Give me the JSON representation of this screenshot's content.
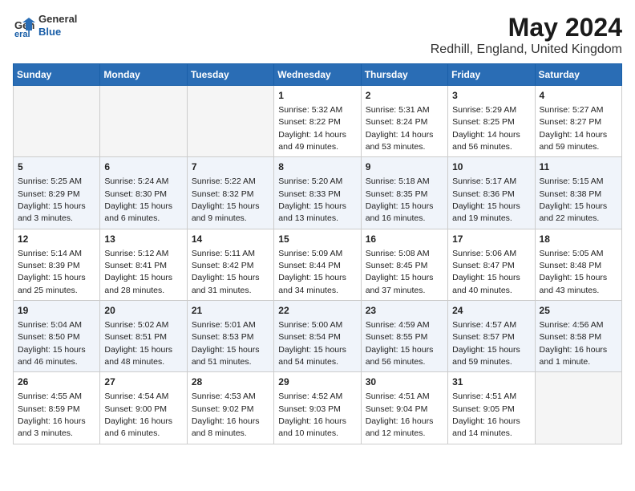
{
  "logo": {
    "line1": "General",
    "line2": "Blue"
  },
  "title": "May 2024",
  "subtitle": "Redhill, England, United Kingdom",
  "headers": [
    "Sunday",
    "Monday",
    "Tuesday",
    "Wednesday",
    "Thursday",
    "Friday",
    "Saturday"
  ],
  "weeks": [
    [
      {
        "day": "",
        "info": ""
      },
      {
        "day": "",
        "info": ""
      },
      {
        "day": "",
        "info": ""
      },
      {
        "day": "1",
        "info": "Sunrise: 5:32 AM\nSunset: 8:22 PM\nDaylight: 14 hours\nand 49 minutes."
      },
      {
        "day": "2",
        "info": "Sunrise: 5:31 AM\nSunset: 8:24 PM\nDaylight: 14 hours\nand 53 minutes."
      },
      {
        "day": "3",
        "info": "Sunrise: 5:29 AM\nSunset: 8:25 PM\nDaylight: 14 hours\nand 56 minutes."
      },
      {
        "day": "4",
        "info": "Sunrise: 5:27 AM\nSunset: 8:27 PM\nDaylight: 14 hours\nand 59 minutes."
      }
    ],
    [
      {
        "day": "5",
        "info": "Sunrise: 5:25 AM\nSunset: 8:29 PM\nDaylight: 15 hours\nand 3 minutes."
      },
      {
        "day": "6",
        "info": "Sunrise: 5:24 AM\nSunset: 8:30 PM\nDaylight: 15 hours\nand 6 minutes."
      },
      {
        "day": "7",
        "info": "Sunrise: 5:22 AM\nSunset: 8:32 PM\nDaylight: 15 hours\nand 9 minutes."
      },
      {
        "day": "8",
        "info": "Sunrise: 5:20 AM\nSunset: 8:33 PM\nDaylight: 15 hours\nand 13 minutes."
      },
      {
        "day": "9",
        "info": "Sunrise: 5:18 AM\nSunset: 8:35 PM\nDaylight: 15 hours\nand 16 minutes."
      },
      {
        "day": "10",
        "info": "Sunrise: 5:17 AM\nSunset: 8:36 PM\nDaylight: 15 hours\nand 19 minutes."
      },
      {
        "day": "11",
        "info": "Sunrise: 5:15 AM\nSunset: 8:38 PM\nDaylight: 15 hours\nand 22 minutes."
      }
    ],
    [
      {
        "day": "12",
        "info": "Sunrise: 5:14 AM\nSunset: 8:39 PM\nDaylight: 15 hours\nand 25 minutes."
      },
      {
        "day": "13",
        "info": "Sunrise: 5:12 AM\nSunset: 8:41 PM\nDaylight: 15 hours\nand 28 minutes."
      },
      {
        "day": "14",
        "info": "Sunrise: 5:11 AM\nSunset: 8:42 PM\nDaylight: 15 hours\nand 31 minutes."
      },
      {
        "day": "15",
        "info": "Sunrise: 5:09 AM\nSunset: 8:44 PM\nDaylight: 15 hours\nand 34 minutes."
      },
      {
        "day": "16",
        "info": "Sunrise: 5:08 AM\nSunset: 8:45 PM\nDaylight: 15 hours\nand 37 minutes."
      },
      {
        "day": "17",
        "info": "Sunrise: 5:06 AM\nSunset: 8:47 PM\nDaylight: 15 hours\nand 40 minutes."
      },
      {
        "day": "18",
        "info": "Sunrise: 5:05 AM\nSunset: 8:48 PM\nDaylight: 15 hours\nand 43 minutes."
      }
    ],
    [
      {
        "day": "19",
        "info": "Sunrise: 5:04 AM\nSunset: 8:50 PM\nDaylight: 15 hours\nand 46 minutes."
      },
      {
        "day": "20",
        "info": "Sunrise: 5:02 AM\nSunset: 8:51 PM\nDaylight: 15 hours\nand 48 minutes."
      },
      {
        "day": "21",
        "info": "Sunrise: 5:01 AM\nSunset: 8:53 PM\nDaylight: 15 hours\nand 51 minutes."
      },
      {
        "day": "22",
        "info": "Sunrise: 5:00 AM\nSunset: 8:54 PM\nDaylight: 15 hours\nand 54 minutes."
      },
      {
        "day": "23",
        "info": "Sunrise: 4:59 AM\nSunset: 8:55 PM\nDaylight: 15 hours\nand 56 minutes."
      },
      {
        "day": "24",
        "info": "Sunrise: 4:57 AM\nSunset: 8:57 PM\nDaylight: 15 hours\nand 59 minutes."
      },
      {
        "day": "25",
        "info": "Sunrise: 4:56 AM\nSunset: 8:58 PM\nDaylight: 16 hours\nand 1 minute."
      }
    ],
    [
      {
        "day": "26",
        "info": "Sunrise: 4:55 AM\nSunset: 8:59 PM\nDaylight: 16 hours\nand 3 minutes."
      },
      {
        "day": "27",
        "info": "Sunrise: 4:54 AM\nSunset: 9:00 PM\nDaylight: 16 hours\nand 6 minutes."
      },
      {
        "day": "28",
        "info": "Sunrise: 4:53 AM\nSunset: 9:02 PM\nDaylight: 16 hours\nand 8 minutes."
      },
      {
        "day": "29",
        "info": "Sunrise: 4:52 AM\nSunset: 9:03 PM\nDaylight: 16 hours\nand 10 minutes."
      },
      {
        "day": "30",
        "info": "Sunrise: 4:51 AM\nSunset: 9:04 PM\nDaylight: 16 hours\nand 12 minutes."
      },
      {
        "day": "31",
        "info": "Sunrise: 4:51 AM\nSunset: 9:05 PM\nDaylight: 16 hours\nand 14 minutes."
      },
      {
        "day": "",
        "info": ""
      }
    ]
  ]
}
